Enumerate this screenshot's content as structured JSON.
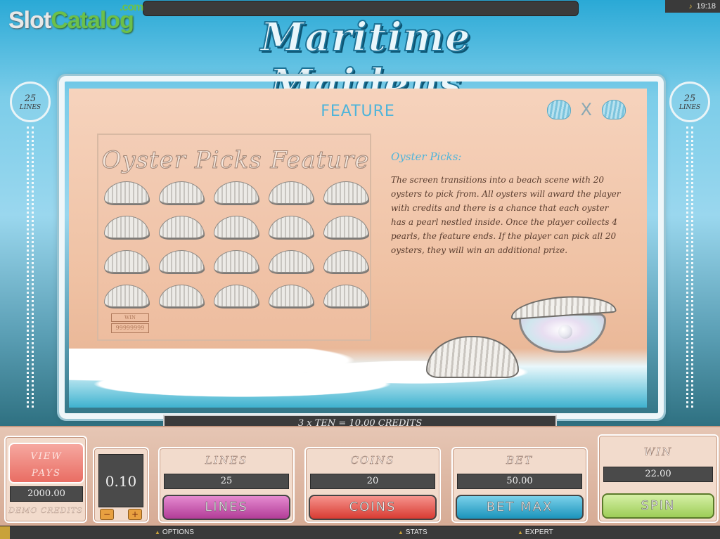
{
  "branding": {
    "slot": "Slot",
    "catalog": "Catalog",
    "com": ".com"
  },
  "status_bar": {
    "time": "19:18"
  },
  "game": {
    "title": "Maritime Maidens",
    "lines_badge_number": "25",
    "lines_badge_label": "LINES"
  },
  "feature_panel": {
    "heading": "FEATURE",
    "close_label": "X",
    "preview": {
      "title": "Oyster Picks Feature",
      "win_label": "WIN",
      "win_value": "99999999",
      "oyster_count": 20
    },
    "section_heading": "Oyster Picks:",
    "description": "The screen transitions into a beach scene with 20 oysters to pick from. All oysters will award the player with credits and there is a chance that each oyster has a pearl nestled inside. Once the player collects 4 pearls, the feature ends. If the player can pick all 20 oysters, they will win an additional prize."
  },
  "info_bar": {
    "message": "3 x TEN  =  10.00 CREDITS"
  },
  "controls": {
    "view_pays_label_1": "VIEW",
    "view_pays_label_2": "PAYS",
    "credits_value": "2000.00",
    "credits_label": "DEMO CREDITS",
    "denomination": "0.10",
    "denom_minus": "−",
    "denom_plus": "+",
    "lines": {
      "label": "LINES",
      "value": "25",
      "button": "LINES"
    },
    "coins": {
      "label": "COINS",
      "value": "20",
      "button": "COINS"
    },
    "bet": {
      "label": "BET",
      "value": "50.00",
      "button": "BET MAX"
    },
    "win": {
      "label": "WIN",
      "value": "22.00",
      "button": "SPIN"
    }
  },
  "bottom_bar": {
    "options": "OPTIONS",
    "stats": "STATS",
    "expert": "EXPERT"
  }
}
